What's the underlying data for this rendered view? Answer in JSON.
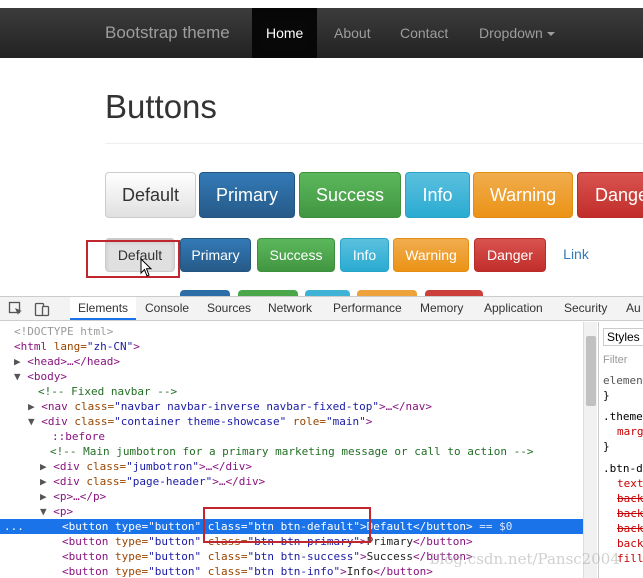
{
  "navbar": {
    "brand": "Bootstrap theme",
    "links": [
      {
        "label": "Home",
        "active": true
      },
      {
        "label": "About",
        "active": false
      },
      {
        "label": "Contact",
        "active": false
      },
      {
        "label": "Dropdown",
        "active": false
      }
    ]
  },
  "page": {
    "heading": "Buttons",
    "large_buttons": [
      "Default",
      "Primary",
      "Success",
      "Info",
      "Warning",
      "Dange"
    ],
    "buttons": [
      "Default",
      "Primary",
      "Success",
      "Info",
      "Warning",
      "Danger",
      "Link"
    ]
  },
  "devtools": {
    "tabs": [
      "Elements",
      "Console",
      "Sources",
      "Network",
      "Performance",
      "Memory",
      "Application",
      "Security",
      "Au"
    ],
    "active_tab": "Elements",
    "dom_lines": [
      {
        "t": "<!DOCTYPE html>"
      },
      {
        "t1": "<html",
        "a": " lang=",
        "v": "\"zh-CN\"",
        "t2": ">"
      },
      {
        "tri": "▶",
        "t": "<head>…</head>"
      },
      {
        "tri": "▼",
        "t": "<body>"
      },
      {
        "c": "<!-- Fixed navbar -->"
      },
      {
        "tri": "▶",
        "t1": "<nav",
        "a": " class=",
        "v": "\"navbar navbar-inverse navbar-fixed-top\"",
        "t2": ">…</nav>"
      },
      {
        "tri": "▼",
        "t1": "<div",
        "a": " class=",
        "v": "\"container theme-showcase\"",
        "a2": " role=",
        "v2": "\"main\"",
        "t2": ">"
      },
      {
        "pseudo": "::before"
      },
      {
        "c": "<!-- Main jumbotron for a primary marketing message or call to action -->"
      },
      {
        "tri": "▶",
        "t1": "<div",
        "a": " class=",
        "v": "\"jumbotron\"",
        "t2": ">…</div>"
      },
      {
        "tri": "▶",
        "t1": "<div",
        "a": " class=",
        "v": "\"page-header\"",
        "t2": ">…</div>"
      },
      {
        "tri": "▶",
        "t": "<p>…</p>"
      },
      {
        "tri": "▼",
        "t": "<p>"
      },
      {
        "t1": "<button",
        "a": " type=",
        "v": "\"button\"",
        "a2": " class=",
        "v2": "\"btn btn-default\"",
        "t2": ">",
        "x": "Default",
        "t3": "</button>",
        "s": " == $0"
      },
      {
        "t1": "<button",
        "a": " type=",
        "v": "\"button\"",
        "a2": " class=",
        "v2": "\"btn btn-primary\"",
        "t2": ">",
        "x": "Primary",
        "t3": "</button>"
      },
      {
        "t1": "<button",
        "a": " type=",
        "v": "\"button\"",
        "a2": " class=",
        "v2": "\"btn btn-success\"",
        "t2": ">",
        "x": "Success",
        "t3": "</button>"
      },
      {
        "t1": "<button",
        "a": " type=",
        "v": "\"button\"",
        "a2": " class=",
        "v2": "\"btn btn-info\"",
        "t2": ">",
        "x": "Info",
        "t3": "</button>"
      }
    ],
    "styles_panel": [
      "Styles",
      "Filter",
      "element",
      "}",
      ".theme",
      "marg",
      "}",
      ".btn-d",
      "text",
      "back",
      "back",
      "back",
      "back",
      "fill"
    ],
    "selected_marker": "..."
  },
  "watermark": "blog.csdn.net/Pansc2004"
}
